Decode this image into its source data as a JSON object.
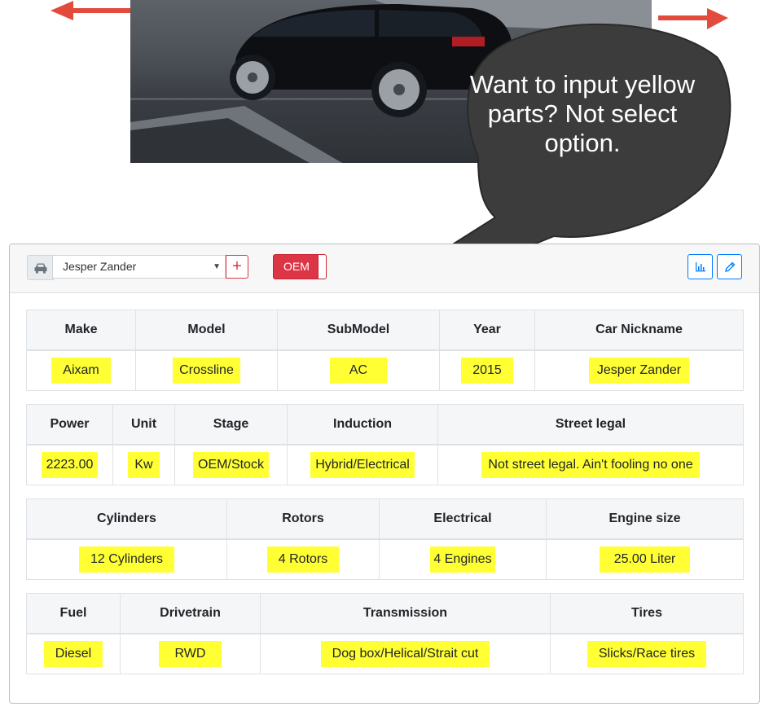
{
  "annotation": {
    "callout_text": "Want to input yellow parts? Not select option.",
    "arrow_color": "#e24b3c",
    "bubble_color": "#3c3c3c",
    "highlight_color": "#ffff33"
  },
  "toolbar": {
    "car_icon": "car-icon",
    "selected_car": "Jesper Zander",
    "add_label": "+",
    "oem_label": "OEM",
    "oem_color": "#dc3545",
    "chart_icon": "bar-chart-icon",
    "edit_icon": "pencil-icon"
  },
  "tables": [
    {
      "headers": [
        "Make",
        "Model",
        "SubModel",
        "Year",
        "Car Nickname"
      ],
      "values": [
        "Aixam",
        "Crossline",
        "AC",
        "2015",
        "Jesper Zander"
      ]
    },
    {
      "headers": [
        "Power",
        "Unit",
        "Stage",
        "Induction",
        "Street legal"
      ],
      "values": [
        "2223.00",
        "Kw",
        "OEM/Stock",
        "Hybrid/Electrical",
        "Not street legal. Ain't fooling no one"
      ]
    },
    {
      "headers": [
        "Cylinders",
        "Rotors",
        "Electrical",
        "Engine size"
      ],
      "values": [
        "12 Cylinders",
        "4 Rotors",
        "4 Engines",
        "25.00 Liter"
      ]
    },
    {
      "headers": [
        "Fuel",
        "Drivetrain",
        "Transmission",
        "Tires"
      ],
      "values": [
        "Diesel",
        "RWD",
        "Dog box/Helical/Strait cut",
        "Slicks/Race tires"
      ]
    }
  ]
}
